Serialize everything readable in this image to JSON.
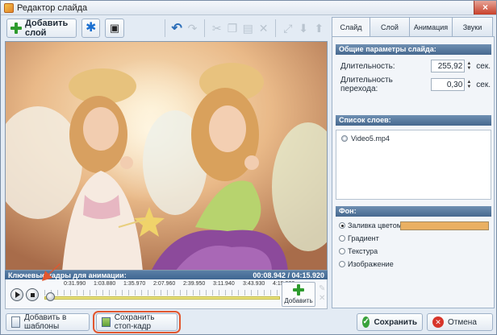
{
  "window": {
    "title": "Редактор слайда",
    "close_glyph": "×"
  },
  "toolbar": {
    "add_layer_label": "Добавить слой",
    "icons": [
      "star-icon",
      "ghost-icon",
      "undo-icon",
      "redo-icon",
      "cut-icon",
      "copy-icon",
      "paste-icon",
      "delete-icon",
      "fit-icon",
      "move-down-icon",
      "move-up-icon"
    ]
  },
  "timeline": {
    "header_label": "Ключевые кадры для анимации:",
    "time_display": "00:08.942 / 04:15.920",
    "ticks": [
      "0:31.990",
      "1:03.880",
      "1:35.970",
      "2:07.960",
      "2:39.950",
      "3:11.940",
      "3:43.930",
      "4:15.920"
    ],
    "add_label": "Добавить"
  },
  "bottom": {
    "templates_label": "Добавить в шаблоны",
    "snapshot_label": "Сохранить стоп-кадр",
    "save_label": "Сохранить",
    "cancel_label": "Отмена"
  },
  "tabs": [
    "Слайд",
    "Слой",
    "Анимация",
    "Звуки"
  ],
  "general": {
    "header": "Общие параметры слайда:",
    "duration_label": "Длительность:",
    "duration_value": "255,92",
    "transition_label": "Длительность перехода:",
    "transition_value": "0,30",
    "unit": "сек."
  },
  "layers": {
    "header": "Список слоев:",
    "items": [
      "Video5.mp4"
    ]
  },
  "background": {
    "header": "Фон:",
    "options": [
      "Заливка цветом",
      "Градиент",
      "Текстура",
      "Изображение"
    ],
    "selected": "Заливка цветом",
    "fill_color": "#eab062"
  },
  "colors": {
    "accent_ring": "#e2572f",
    "section_header": "#46688f"
  }
}
